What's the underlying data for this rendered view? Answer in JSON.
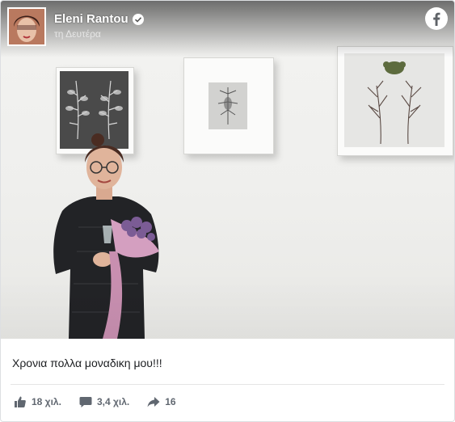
{
  "post": {
    "author": "Eleni Rantou",
    "timestamp": "τη Δευτέρα",
    "caption": "Χρονια πολλα μοναδικη μου!!!",
    "stats": {
      "likes": "18 χιλ.",
      "comments": "3,4 χιλ.",
      "shares": "16"
    }
  },
  "icons": {
    "verified": "verified-badge-icon",
    "logo": "facebook-logo-icon",
    "like": "thumbs-up-icon",
    "comment": "comment-bubble-icon",
    "share": "share-arrow-icon"
  },
  "colors": {
    "facebook_blue": "#1877f2",
    "text": "#1c1e21",
    "meta": "#606770"
  }
}
